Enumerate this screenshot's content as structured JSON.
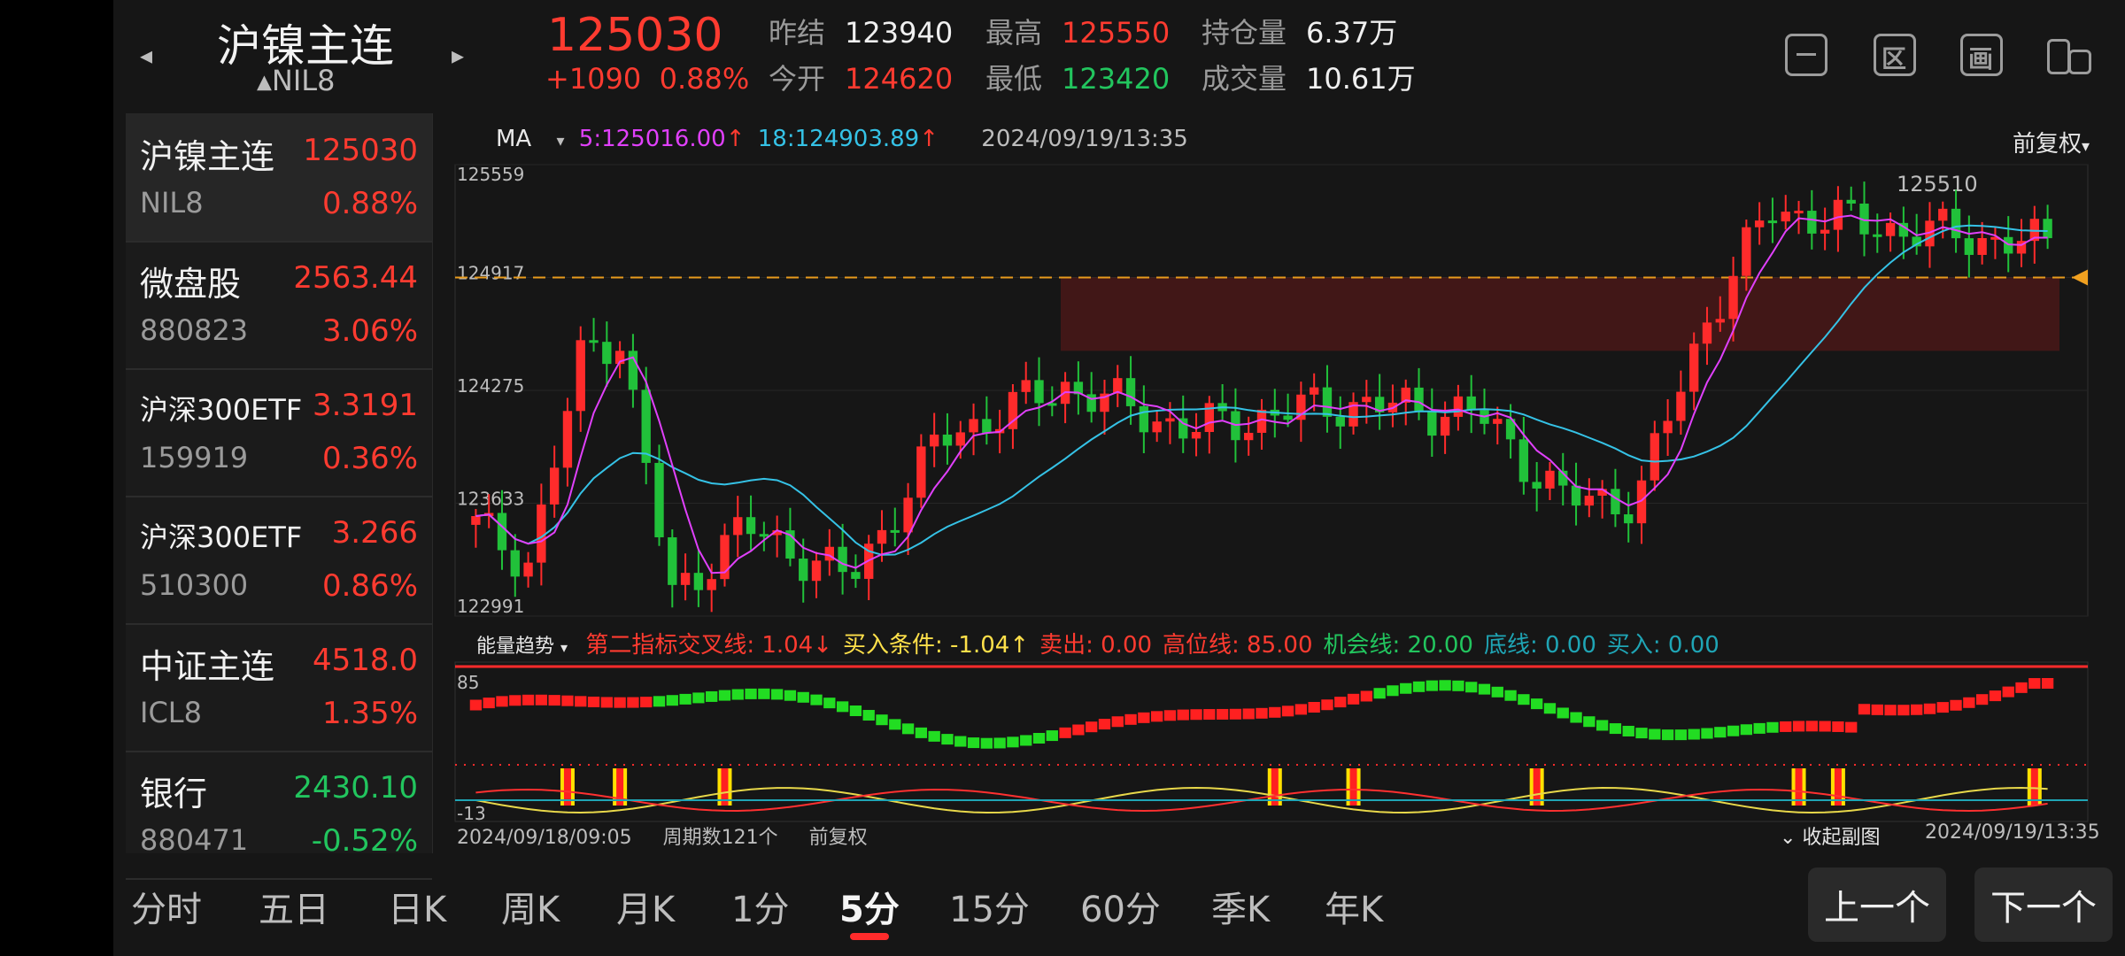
{
  "header": {
    "title": "沪镍主连",
    "code": "NIL8",
    "last_price": "125030",
    "change": "+1090",
    "change_pct": "0.88%",
    "stats": [
      {
        "label": "昨结",
        "value": "123940",
        "color": "#f0f0f0"
      },
      {
        "label": "今开",
        "value": "124620",
        "color": "#ff3b30"
      },
      {
        "label": "最高",
        "value": "125550",
        "color": "#ff3b30"
      },
      {
        "label": "最低",
        "value": "123420",
        "color": "#22c55e"
      },
      {
        "label": "持仓量",
        "value": "6.37万",
        "color": "#f0f0f0"
      },
      {
        "label": "成交量",
        "value": "10.61万",
        "color": "#f0f0f0"
      }
    ],
    "icons": [
      "minimize-icon",
      "region-icon",
      "canvas-icon",
      "split-screen-icon"
    ]
  },
  "watchlist": [
    {
      "name": "沪镍主连",
      "price": "125030",
      "code": "NIL8",
      "pct": "0.88%",
      "up": true
    },
    {
      "name": "微盘股",
      "price": "2563.44",
      "code": "880823",
      "pct": "3.06%",
      "up": true
    },
    {
      "name": "沪深300ETF",
      "price": "3.3191",
      "code": "159919",
      "pct": "0.36%",
      "up": true
    },
    {
      "name": "沪深300ETF",
      "price": "3.266",
      "code": "510300",
      "pct": "0.86%",
      "up": true
    },
    {
      "name": "中证主连",
      "price": "4518.0",
      "code": "ICL8",
      "pct": "1.35%",
      "up": true
    },
    {
      "name": "银行",
      "price": "2430.10",
      "code": "880471",
      "pct": "-0.52%",
      "up": false
    }
  ],
  "chart": {
    "ma_label": "MA",
    "ma5": "5:125016.00",
    "ma18": "18:124903.89",
    "timestamp": "2024/09/19/13:35",
    "adjust": "前复权",
    "y_labels": [
      "125559",
      "124917",
      "124275",
      "123633",
      "122991"
    ],
    "high_marker": "125510",
    "indicator_name": "能量趋势",
    "ind_items": [
      {
        "text": "第二指标交叉线: 1.04↓",
        "color": "#ff3b30"
      },
      {
        "text": "买入条件: -1.04↑",
        "color": "#ffe04a"
      },
      {
        "text": "卖出: 0.00",
        "color": "#ff3b30"
      },
      {
        "text": "高位线: 85.00",
        "color": "#ff3b30"
      },
      {
        "text": "机会线: 20.00",
        "color": "#22c55e"
      },
      {
        "text": "底线: 0.00",
        "color": "#1fa5b5"
      },
      {
        "text": "买入: 0.00",
        "color": "#1fa5b5"
      }
    ],
    "ind_top": "85",
    "ind_bottom": "-13",
    "start_time": "2024/09/18/09:05",
    "period_count": "周期数121个",
    "adjust2": "前复权",
    "collapse": "收起副图",
    "end_time": "2024/09/19/13:35"
  },
  "tabs": [
    "分时",
    "五日",
    "日K",
    "周K",
    "月K",
    "1分",
    "5分",
    "15分",
    "60分",
    "季K",
    "年K"
  ],
  "active_tab": "5分",
  "nav": {
    "prev": "上一个",
    "next": "下一个"
  },
  "chart_data": {
    "type": "candlestick",
    "ylim": [
      122991,
      125559
    ],
    "reference_line": 124917,
    "colors": {
      "up": "#ff2b2b",
      "down": "#21c13a",
      "ma5": "#e040fb",
      "ma18": "#35c2e6"
    }
  }
}
